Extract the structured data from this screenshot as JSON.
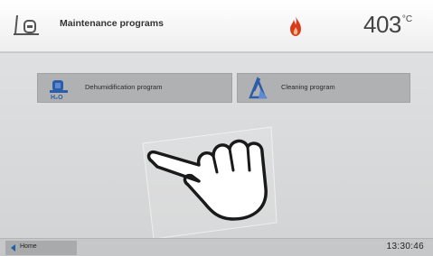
{
  "header": {
    "title": "Maintenance programs",
    "temperature": "403",
    "temperature_unit": "°C",
    "left_icon": "furnace-maintenance-icon",
    "status_icon": "flame-icon"
  },
  "programs": [
    {
      "label": "Dehumidification program",
      "icon": "dehumidification-icon"
    },
    {
      "label": "Cleaning program",
      "icon": "cleaning-icon"
    }
  ],
  "footer": {
    "home_label": "Home",
    "clock": "13:30:46"
  },
  "colors": {
    "accent_blue": "#1e5fa8",
    "flame": "#d93a1a",
    "button_gray": "#b0b1b2"
  }
}
